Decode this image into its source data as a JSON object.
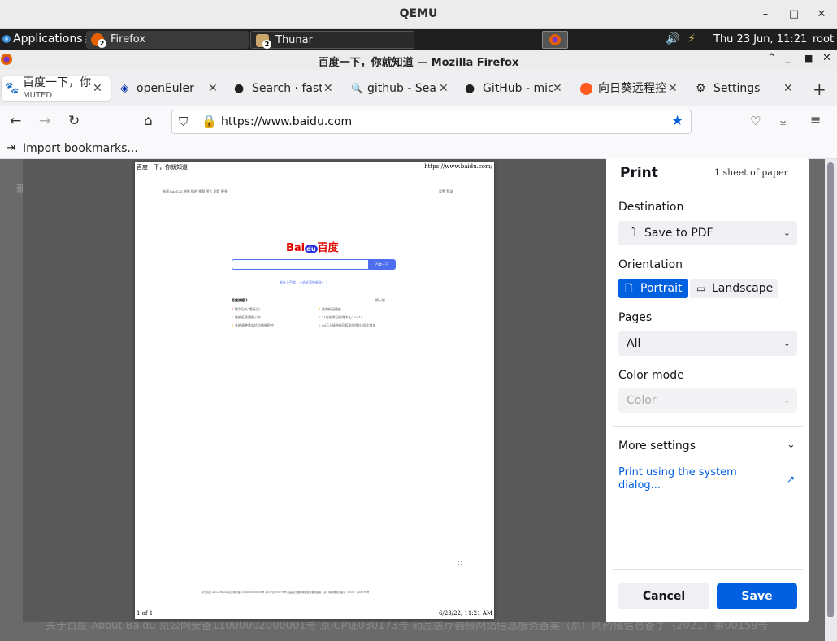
{
  "qemu": {
    "title": "QEMU",
    "min": "–",
    "max": "□",
    "close": "✕"
  },
  "panel": {
    "applications": "Applications",
    "tasks": [
      {
        "label": "Firefox",
        "count": "2"
      },
      {
        "label": "Thunar",
        "count": "2"
      }
    ],
    "datetime": "Thu 23 Jun, 11:21",
    "user": "root"
  },
  "firefox": {
    "window_title": "百度一下，你就知道 — Mozilla Firefox",
    "tabs": [
      {
        "label": "百度一下，你",
        "sub": "MUTED"
      },
      {
        "label": "openEuler"
      },
      {
        "label": "Search · fast"
      },
      {
        "label": "github - Sea"
      },
      {
        "label": "GitHub - mic"
      },
      {
        "label": "向日葵远程控"
      },
      {
        "label": "Settings"
      }
    ],
    "url": "https://www.baidu.com",
    "import_bookmarks": "Import bookmarks..."
  },
  "page_behind": {
    "left_char": "新",
    "footer": "关于百度   About Baidu   京公网安备11000002000001号   京ICP证030173号   药品医疗器械网络信息服务备案（京）网药械信息备字（2021）第00159号"
  },
  "preview": {
    "header_left": "百度一下，你就知道",
    "header_right": "https://www.baidu.com/",
    "footer_left": "1 of 1",
    "footer_right": "6/23/22, 11:21 AM",
    "logo_bai": "Bai",
    "logo_du": "du",
    "logo_cn": "百度",
    "search_button": "百度一下",
    "nav_links": "新闻   hao123   地图   贴吧   视频   图片   网盘   更多",
    "nav_right": "设置    登录",
    "hint": "新年上百度，一站式宠你新年！ 》",
    "hot_title": "百度热搜 》",
    "hot_refresh": "换一换",
    "hot_items": [
      "稳字当头“看行当”",
      "最新疫情通报公布",
      "多地调整落实优化措施防控",
      "香港新冠最新",
      "31省份昨日新增本土13+18",
      "46万人接种新冠疫苗加强针 同比增长"
    ],
    "page_footer": "关于百度   About Baidu   京公网安备11000002000001号   京ICP证030173号   药品医疗器械网络信息服务备案（京）网药械信息备字（2021）第00159号"
  },
  "print": {
    "title": "Print",
    "sheets": "1 sheet of paper",
    "destination_label": "Destination",
    "destination_value": "Save to PDF",
    "orientation_label": "Orientation",
    "portrait": "Portrait",
    "landscape": "Landscape",
    "pages_label": "Pages",
    "pages_value": "All",
    "color_label": "Color mode",
    "color_value": "Color",
    "more_settings": "More settings",
    "system_dialog": "Print using the system dialog...",
    "cancel": "Cancel",
    "save": "Save",
    "accent": "#0060df"
  }
}
